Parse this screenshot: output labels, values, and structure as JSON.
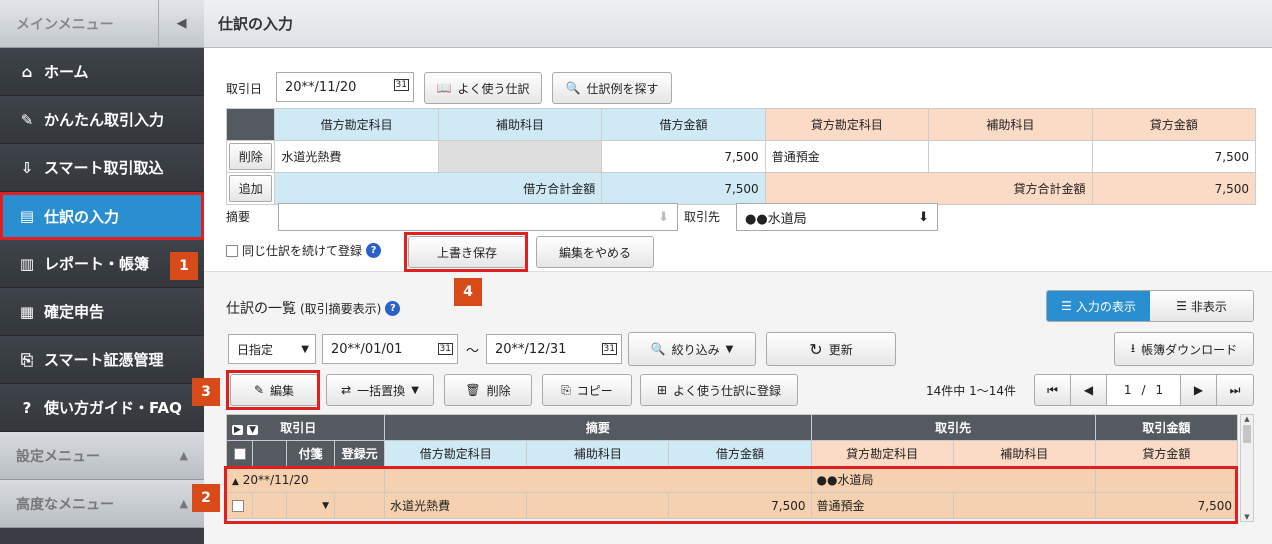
{
  "sidebar": {
    "header": "メインメニュー",
    "items": [
      {
        "label": "ホーム"
      },
      {
        "label": "かんたん取引入力"
      },
      {
        "label": "スマート取引取込"
      },
      {
        "label": "仕訳の入力"
      },
      {
        "label": "レポート・帳簿"
      },
      {
        "label": "確定申告"
      },
      {
        "label": "スマート証憑管理"
      },
      {
        "label": "使い方ガイド・FAQ"
      }
    ],
    "settings": "設定メニュー",
    "advanced": "高度なメニュー"
  },
  "badges": [
    "1",
    "2",
    "3",
    "4"
  ],
  "page_title": "仕訳の入力",
  "entry": {
    "date_label": "取引日",
    "date": "20**/11/20",
    "cal": "31",
    "btn_favorites": "よく使う仕訳",
    "btn_search": "仕訳例を探す",
    "headers": [
      "借方勘定科目",
      "補助科目",
      "借方金額",
      "貸方勘定科目",
      "補助科目",
      "貸方金額"
    ],
    "delete": "削除",
    "add": "追加",
    "row": {
      "debit_account": "水道光熱費",
      "debit_sub": "",
      "debit_amount": "7,500",
      "credit_account": "普通預金",
      "credit_sub": "",
      "credit_amount": "7,500"
    },
    "debit_total_label": "借方合計金額",
    "debit_total": "7,500",
    "credit_total_label": "貸方合計金額",
    "credit_total": "7,500",
    "memo_label": "摘要",
    "partner_label": "取引先",
    "partner": "●●水道局",
    "same_label": "同じ仕訳を続けて登録",
    "overwrite": "上書き保存",
    "cancel": "編集をやめる"
  },
  "list": {
    "title": "仕訳の一覧",
    "subtitle": "(取引摘要表示)",
    "toggle_on": "入力の表示",
    "toggle_off": "非表示",
    "period": "日指定",
    "from": "20**/01/01",
    "tilde": "～",
    "to": "20**/12/31",
    "narrow": "絞り込み",
    "refresh": "更新",
    "download": "帳簿ダウンロード",
    "edit": "編集",
    "bulk": "一括置換",
    "delete": "削除",
    "copy": "コピー",
    "register": "よく使う仕訳に登録",
    "count": "14件中 1～14件",
    "page": "1",
    "slash": "/",
    "pages": "1",
    "headers": {
      "date": "取引日",
      "memo": "摘要",
      "partner": "取引先",
      "amount": "取引金額",
      "tag": "付箋",
      "source": "登録元",
      "debit_account": "借方勘定科目",
      "debit_sub": "補助科目",
      "debit_amount": "借方金額",
      "credit_account": "貸方勘定科目",
      "credit_sub": "補助科目",
      "credit_amount": "貸方金額"
    },
    "row": {
      "date": "20**/11/20",
      "partner": "●●水道局",
      "debit_account": "水道光熱費",
      "debit_amount": "7,500",
      "credit_account": "普通預金",
      "credit_amount": "7,500"
    }
  }
}
